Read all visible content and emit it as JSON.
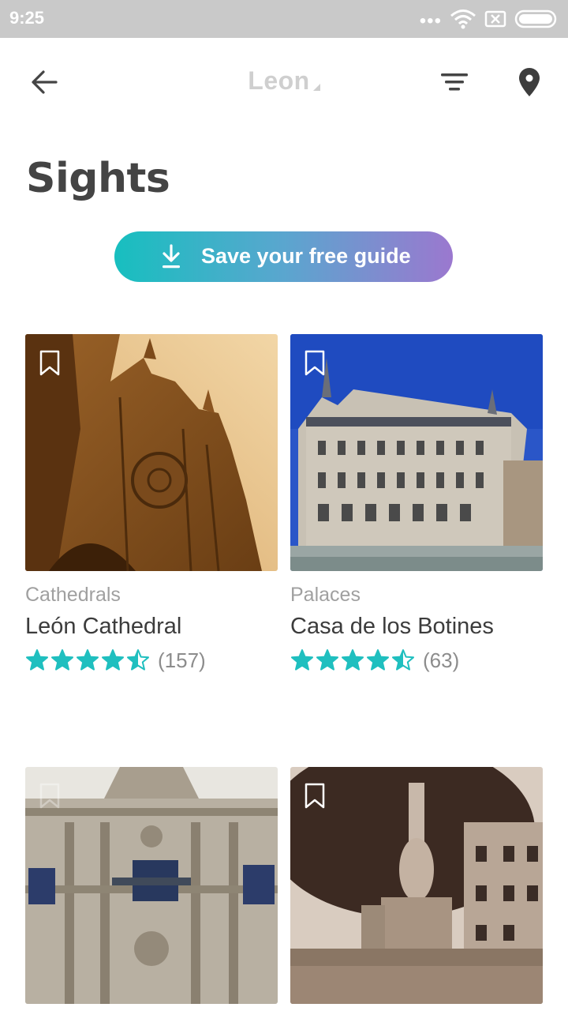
{
  "status_bar": {
    "time": "9:25",
    "dots": "•••"
  },
  "app_bar": {
    "city": "Leon"
  },
  "page": {
    "title": "Sights"
  },
  "save_guide": {
    "label": "Save your free guide"
  },
  "colors": {
    "accent": "#1cbfbf",
    "gradient_end": "#9b78cf",
    "star": "#1fbfbf"
  },
  "cards": [
    {
      "category": "Cathedrals",
      "name": "León Cathedral",
      "rating": 4.5,
      "reviews": "(157)"
    },
    {
      "category": "Palaces",
      "name": "Casa de los Botines",
      "rating": 4.5,
      "reviews": "(63)"
    },
    {
      "category": "",
      "name": "",
      "rating": null,
      "reviews": ""
    },
    {
      "category": "",
      "name": "",
      "rating": null,
      "reviews": ""
    }
  ]
}
